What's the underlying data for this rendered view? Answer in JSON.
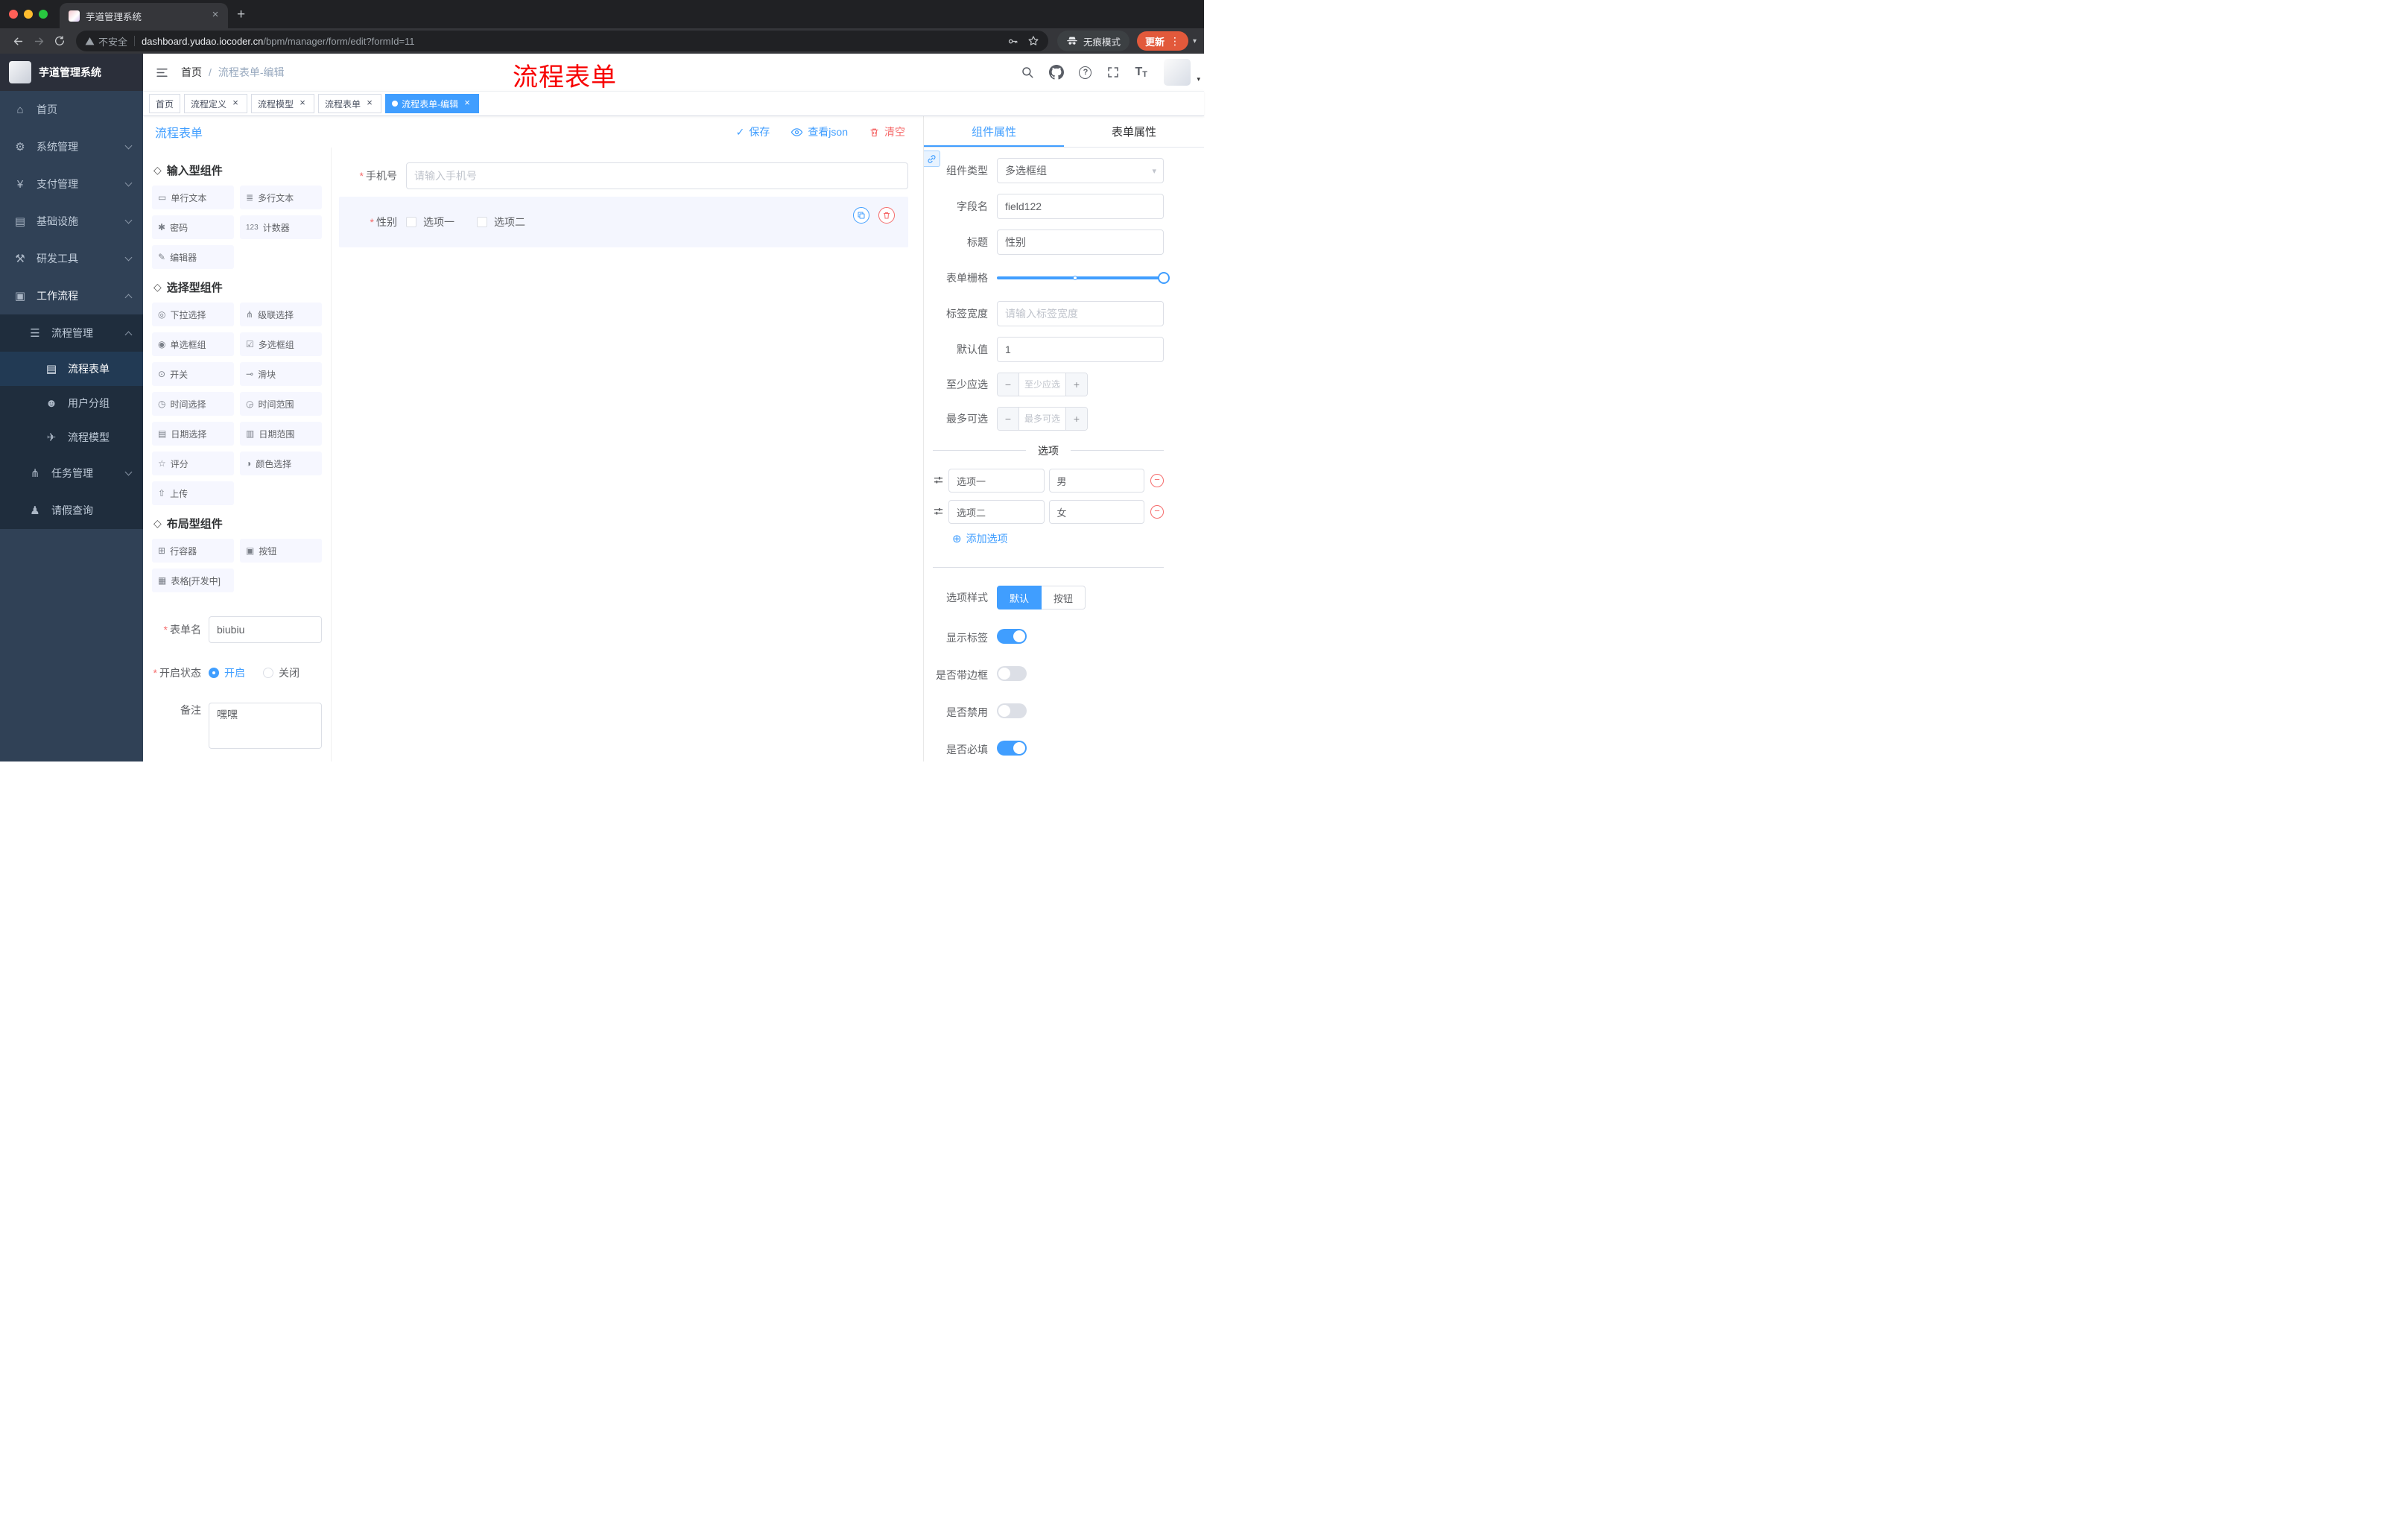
{
  "glyphs": {
    "asterisk": "*",
    "check": "✓",
    "close": "×",
    "plus": "+",
    "minus": "−",
    "caret_down": "▾",
    "slash": "/",
    "add_circle": "⊕",
    "more_vertical": "⋮",
    "question": "?",
    "section": "◇",
    "t_large": "T",
    "t_small": "T"
  },
  "browser": {
    "tab_title": "芋道管理系统",
    "security_label": "不安全",
    "url_host": "dashboard.yudao.iocoder.cn",
    "url_path": "/bpm/manager/form/edit?formId=11",
    "incognito_label": "无痕模式",
    "update_label": "更新"
  },
  "annotation": "流程表单",
  "sidebar": {
    "logo_title": "芋道管理系统",
    "menu": [
      {
        "label": "首页",
        "icon": "⌂"
      },
      {
        "label": "系统管理",
        "icon": "⚙"
      },
      {
        "label": "支付管理",
        "icon": "¥"
      },
      {
        "label": "基础设施",
        "icon": "▤"
      },
      {
        "label": "研发工具",
        "icon": "⚒"
      },
      {
        "label": "工作流程",
        "icon": "▣"
      }
    ],
    "process_mgmt": {
      "label": "流程管理",
      "icon": "☰"
    },
    "process_children": [
      {
        "label": "流程表单",
        "icon": "▤"
      },
      {
        "label": "用户分组",
        "icon": "☻"
      },
      {
        "label": "流程模型",
        "icon": "✈"
      }
    ],
    "task_mgmt": {
      "label": "任务管理",
      "icon": "⋔"
    },
    "leave_query": {
      "label": "请假查询",
      "icon": "♟"
    }
  },
  "navbar": {
    "breadcrumb_home": "首页",
    "breadcrumb_current": "流程表单-编辑"
  },
  "tags": [
    {
      "label": "首页"
    },
    {
      "label": "流程定义"
    },
    {
      "label": "流程模型"
    },
    {
      "label": "流程表单"
    },
    {
      "label": "流程表单-编辑"
    }
  ],
  "designer": {
    "title": "流程表单",
    "save": "保存",
    "view_json": "查看json",
    "clear": "清空",
    "palette": {
      "sections": [
        {
          "title": "输入型组件",
          "items": [
            {
              "label": "单行文本",
              "icon": "▭"
            },
            {
              "label": "多行文本",
              "icon": "≣"
            },
            {
              "label": "密码",
              "icon": "✱"
            },
            {
              "label": "计数器",
              "icon": "123"
            },
            {
              "label": "编辑器",
              "icon": "✎"
            }
          ]
        },
        {
          "title": "选择型组件",
          "items": [
            {
              "label": "下拉选择",
              "icon": "◎"
            },
            {
              "label": "级联选择",
              "icon": "⋔"
            },
            {
              "label": "单选框组",
              "icon": "◉"
            },
            {
              "label": "多选框组",
              "icon": "☑"
            },
            {
              "label": "开关",
              "icon": "⊙"
            },
            {
              "label": "滑块",
              "icon": "⊸"
            },
            {
              "label": "时间选择",
              "icon": "◷"
            },
            {
              "label": "时间范围",
              "icon": "◶"
            },
            {
              "label": "日期选择",
              "icon": "▤"
            },
            {
              "label": "日期范围",
              "icon": "▥"
            },
            {
              "label": "评分",
              "icon": "☆"
            },
            {
              "label": "颜色选择",
              "icon": "◑"
            },
            {
              "label": "上传",
              "icon": "⇧"
            }
          ]
        },
        {
          "title": "布局型组件",
          "items": [
            {
              "label": "行容器",
              "icon": "⊞"
            },
            {
              "label": "按钮",
              "icon": "▣"
            },
            {
              "label": "表格[开发中]",
              "icon": "▦"
            }
          ]
        }
      ]
    },
    "meta": {
      "name_label": "表单名",
      "name_value": "biubiu",
      "status_label": "开启状态",
      "status_on": "开启",
      "status_off": "关闭",
      "remark_label": "备注",
      "remark_value": "嘿嘿"
    },
    "canvas": {
      "phone_label": "手机号",
      "phone_placeholder": "请输入手机号",
      "gender_label": "性别",
      "gender_option1": "选项一",
      "gender_option2": "选项二"
    }
  },
  "properties": {
    "tab_component": "组件属性",
    "tab_form": "表单属性",
    "component_type_label": "组件类型",
    "component_type_value": "多选框组",
    "field_name_label": "字段名",
    "field_name_value": "field122",
    "title_label": "标题",
    "title_value": "性别",
    "grid_label": "表单栅格",
    "label_width_label": "标签宽度",
    "label_width_placeholder": "请输入标签宽度",
    "default_label": "默认值",
    "default_value": "1",
    "min_label": "至少应选",
    "min_placeholder": "至少应选",
    "max_label": "最多可选",
    "max_placeholder": "最多可选",
    "options_title": "选项",
    "options": [
      {
        "label": "选项一",
        "value": "男"
      },
      {
        "label": "选项二",
        "value": "女"
      }
    ],
    "add_option": "添加选项",
    "style_label": "选项样式",
    "style_default": "默认",
    "style_button": "按钮",
    "switch_show_label": "显示标签",
    "switch_border": "是否带边框",
    "switch_disabled": "是否禁用",
    "switch_required": "是否必填"
  },
  "colors": {
    "primary": "#409EFF",
    "danger": "#F56C6C",
    "sidebar_bg": "#304156",
    "submenu_bg": "#1F2D3D",
    "update_button": "#E2593B",
    "annotation": "#F70000"
  }
}
